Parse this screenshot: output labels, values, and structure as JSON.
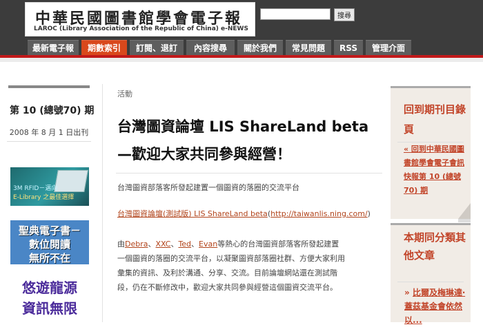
{
  "header": {
    "logo_title": "中華民國圖書館學會電子報",
    "logo_subtitle": "LAROC (Library Association of the Republic of China) e-NEWS",
    "search_placeholder": "",
    "search_button": "搜尋"
  },
  "nav": [
    {
      "label": "最新電子報",
      "active": false
    },
    {
      "label": "期數索引",
      "active": true
    },
    {
      "label": "訂閱、退訂",
      "active": false
    },
    {
      "label": "內容搜尋",
      "active": false
    },
    {
      "label": "關於我們",
      "active": false
    },
    {
      "label": "常見問題",
      "active": false
    },
    {
      "label": "RSS",
      "active": false
    },
    {
      "label": "管理介面",
      "active": false
    }
  ],
  "left": {
    "issue_title": "第 10 (總號70) 期",
    "issue_date": "2008 年 8 月 1 日出刊",
    "banner1": {
      "line1": "3M RFID－邁向",
      "line2": "E-Library 之最佳選擇"
    },
    "banner2": {
      "line1": "聖典電子書－",
      "line2": "數位閱讀",
      "line3": "無所不在"
    },
    "banner3": {
      "line1": "悠遊龍源",
      "line2": "資訊無限"
    }
  },
  "article": {
    "category": "活動",
    "title_line1": "台灣圖資論壇 LIS ShareLand beta",
    "title_line2": "—歡迎大家共同參與經營！",
    "subtitle": "台灣圖資部落客所發起建置一個圖資的落圈的交流平台",
    "link_text": "台灣圖資論壇(測試版) LIS ShareLand beta",
    "link_open": "(",
    "link_url": "http://taiwanlis.ning.com/",
    "link_close": ")",
    "p_prefix": "由",
    "authors": [
      "Debra",
      "XXC",
      "Ted",
      "Evan"
    ],
    "sep": "、",
    "p_line1_rest": "等熱心的台灣圖資部落客所發起建置",
    "p_line2": "一個圖資的落圈的交流平台，以凝聚圖資部落圈社群、方便大家利用",
    "p_line3": "彙集的資訊、及利於溝通、分享、交流。目前論壇網站還在測試階",
    "p_line4": "段，仍在不斷修改中，歡迎大家共同參與經營這個圖資交流平台。"
  },
  "right": {
    "box1_heading": "回到期刊目錄頁",
    "box1_link": "« 回到中華民國圖書館學會電子會訊快報第 10 (總號70) 期",
    "box2_heading": "本期同分類其他文章",
    "box2_bullet": "»",
    "box2_item": "比爾及梅琳達‧蓋茲基金會依然以..."
  },
  "colors": {
    "accent": "#c2191a",
    "nav_active": "#d9481c",
    "link": "#b1431a",
    "sidebar_bg": "#f1ece6"
  }
}
